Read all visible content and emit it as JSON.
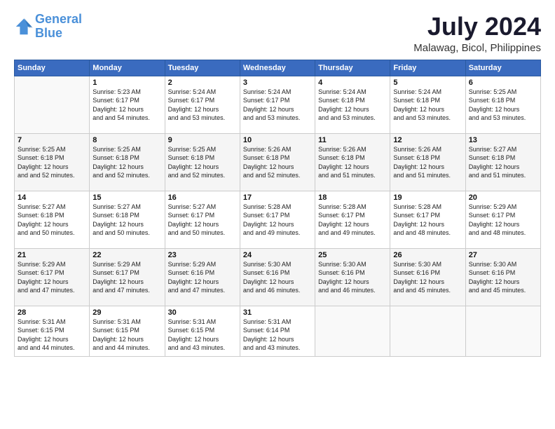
{
  "header": {
    "logo_line1": "General",
    "logo_line2": "Blue",
    "month_year": "July 2024",
    "location": "Malawag, Bicol, Philippines"
  },
  "weekdays": [
    "Sunday",
    "Monday",
    "Tuesday",
    "Wednesday",
    "Thursday",
    "Friday",
    "Saturday"
  ],
  "weeks": [
    [
      {
        "day": "",
        "sunrise": "",
        "sunset": "",
        "daylight": ""
      },
      {
        "day": "1",
        "sunrise": "Sunrise: 5:23 AM",
        "sunset": "Sunset: 6:17 PM",
        "daylight": "Daylight: 12 hours and 54 minutes."
      },
      {
        "day": "2",
        "sunrise": "Sunrise: 5:24 AM",
        "sunset": "Sunset: 6:17 PM",
        "daylight": "Daylight: 12 hours and 53 minutes."
      },
      {
        "day": "3",
        "sunrise": "Sunrise: 5:24 AM",
        "sunset": "Sunset: 6:17 PM",
        "daylight": "Daylight: 12 hours and 53 minutes."
      },
      {
        "day": "4",
        "sunrise": "Sunrise: 5:24 AM",
        "sunset": "Sunset: 6:18 PM",
        "daylight": "Daylight: 12 hours and 53 minutes."
      },
      {
        "day": "5",
        "sunrise": "Sunrise: 5:24 AM",
        "sunset": "Sunset: 6:18 PM",
        "daylight": "Daylight: 12 hours and 53 minutes."
      },
      {
        "day": "6",
        "sunrise": "Sunrise: 5:25 AM",
        "sunset": "Sunset: 6:18 PM",
        "daylight": "Daylight: 12 hours and 53 minutes."
      }
    ],
    [
      {
        "day": "7",
        "sunrise": "Sunrise: 5:25 AM",
        "sunset": "Sunset: 6:18 PM",
        "daylight": "Daylight: 12 hours and 52 minutes."
      },
      {
        "day": "8",
        "sunrise": "Sunrise: 5:25 AM",
        "sunset": "Sunset: 6:18 PM",
        "daylight": "Daylight: 12 hours and 52 minutes."
      },
      {
        "day": "9",
        "sunrise": "Sunrise: 5:25 AM",
        "sunset": "Sunset: 6:18 PM",
        "daylight": "Daylight: 12 hours and 52 minutes."
      },
      {
        "day": "10",
        "sunrise": "Sunrise: 5:26 AM",
        "sunset": "Sunset: 6:18 PM",
        "daylight": "Daylight: 12 hours and 52 minutes."
      },
      {
        "day": "11",
        "sunrise": "Sunrise: 5:26 AM",
        "sunset": "Sunset: 6:18 PM",
        "daylight": "Daylight: 12 hours and 51 minutes."
      },
      {
        "day": "12",
        "sunrise": "Sunrise: 5:26 AM",
        "sunset": "Sunset: 6:18 PM",
        "daylight": "Daylight: 12 hours and 51 minutes."
      },
      {
        "day": "13",
        "sunrise": "Sunrise: 5:27 AM",
        "sunset": "Sunset: 6:18 PM",
        "daylight": "Daylight: 12 hours and 51 minutes."
      }
    ],
    [
      {
        "day": "14",
        "sunrise": "Sunrise: 5:27 AM",
        "sunset": "Sunset: 6:18 PM",
        "daylight": "Daylight: 12 hours and 50 minutes."
      },
      {
        "day": "15",
        "sunrise": "Sunrise: 5:27 AM",
        "sunset": "Sunset: 6:18 PM",
        "daylight": "Daylight: 12 hours and 50 minutes."
      },
      {
        "day": "16",
        "sunrise": "Sunrise: 5:27 AM",
        "sunset": "Sunset: 6:17 PM",
        "daylight": "Daylight: 12 hours and 50 minutes."
      },
      {
        "day": "17",
        "sunrise": "Sunrise: 5:28 AM",
        "sunset": "Sunset: 6:17 PM",
        "daylight": "Daylight: 12 hours and 49 minutes."
      },
      {
        "day": "18",
        "sunrise": "Sunrise: 5:28 AM",
        "sunset": "Sunset: 6:17 PM",
        "daylight": "Daylight: 12 hours and 49 minutes."
      },
      {
        "day": "19",
        "sunrise": "Sunrise: 5:28 AM",
        "sunset": "Sunset: 6:17 PM",
        "daylight": "Daylight: 12 hours and 48 minutes."
      },
      {
        "day": "20",
        "sunrise": "Sunrise: 5:29 AM",
        "sunset": "Sunset: 6:17 PM",
        "daylight": "Daylight: 12 hours and 48 minutes."
      }
    ],
    [
      {
        "day": "21",
        "sunrise": "Sunrise: 5:29 AM",
        "sunset": "Sunset: 6:17 PM",
        "daylight": "Daylight: 12 hours and 47 minutes."
      },
      {
        "day": "22",
        "sunrise": "Sunrise: 5:29 AM",
        "sunset": "Sunset: 6:17 PM",
        "daylight": "Daylight: 12 hours and 47 minutes."
      },
      {
        "day": "23",
        "sunrise": "Sunrise: 5:29 AM",
        "sunset": "Sunset: 6:16 PM",
        "daylight": "Daylight: 12 hours and 47 minutes."
      },
      {
        "day": "24",
        "sunrise": "Sunrise: 5:30 AM",
        "sunset": "Sunset: 6:16 PM",
        "daylight": "Daylight: 12 hours and 46 minutes."
      },
      {
        "day": "25",
        "sunrise": "Sunrise: 5:30 AM",
        "sunset": "Sunset: 6:16 PM",
        "daylight": "Daylight: 12 hours and 46 minutes."
      },
      {
        "day": "26",
        "sunrise": "Sunrise: 5:30 AM",
        "sunset": "Sunset: 6:16 PM",
        "daylight": "Daylight: 12 hours and 45 minutes."
      },
      {
        "day": "27",
        "sunrise": "Sunrise: 5:30 AM",
        "sunset": "Sunset: 6:16 PM",
        "daylight": "Daylight: 12 hours and 45 minutes."
      }
    ],
    [
      {
        "day": "28",
        "sunrise": "Sunrise: 5:31 AM",
        "sunset": "Sunset: 6:15 PM",
        "daylight": "Daylight: 12 hours and 44 minutes."
      },
      {
        "day": "29",
        "sunrise": "Sunrise: 5:31 AM",
        "sunset": "Sunset: 6:15 PM",
        "daylight": "Daylight: 12 hours and 44 minutes."
      },
      {
        "day": "30",
        "sunrise": "Sunrise: 5:31 AM",
        "sunset": "Sunset: 6:15 PM",
        "daylight": "Daylight: 12 hours and 43 minutes."
      },
      {
        "day": "31",
        "sunrise": "Sunrise: 5:31 AM",
        "sunset": "Sunset: 6:14 PM",
        "daylight": "Daylight: 12 hours and 43 minutes."
      },
      {
        "day": "",
        "sunrise": "",
        "sunset": "",
        "daylight": ""
      },
      {
        "day": "",
        "sunrise": "",
        "sunset": "",
        "daylight": ""
      },
      {
        "day": "",
        "sunrise": "",
        "sunset": "",
        "daylight": ""
      }
    ]
  ]
}
